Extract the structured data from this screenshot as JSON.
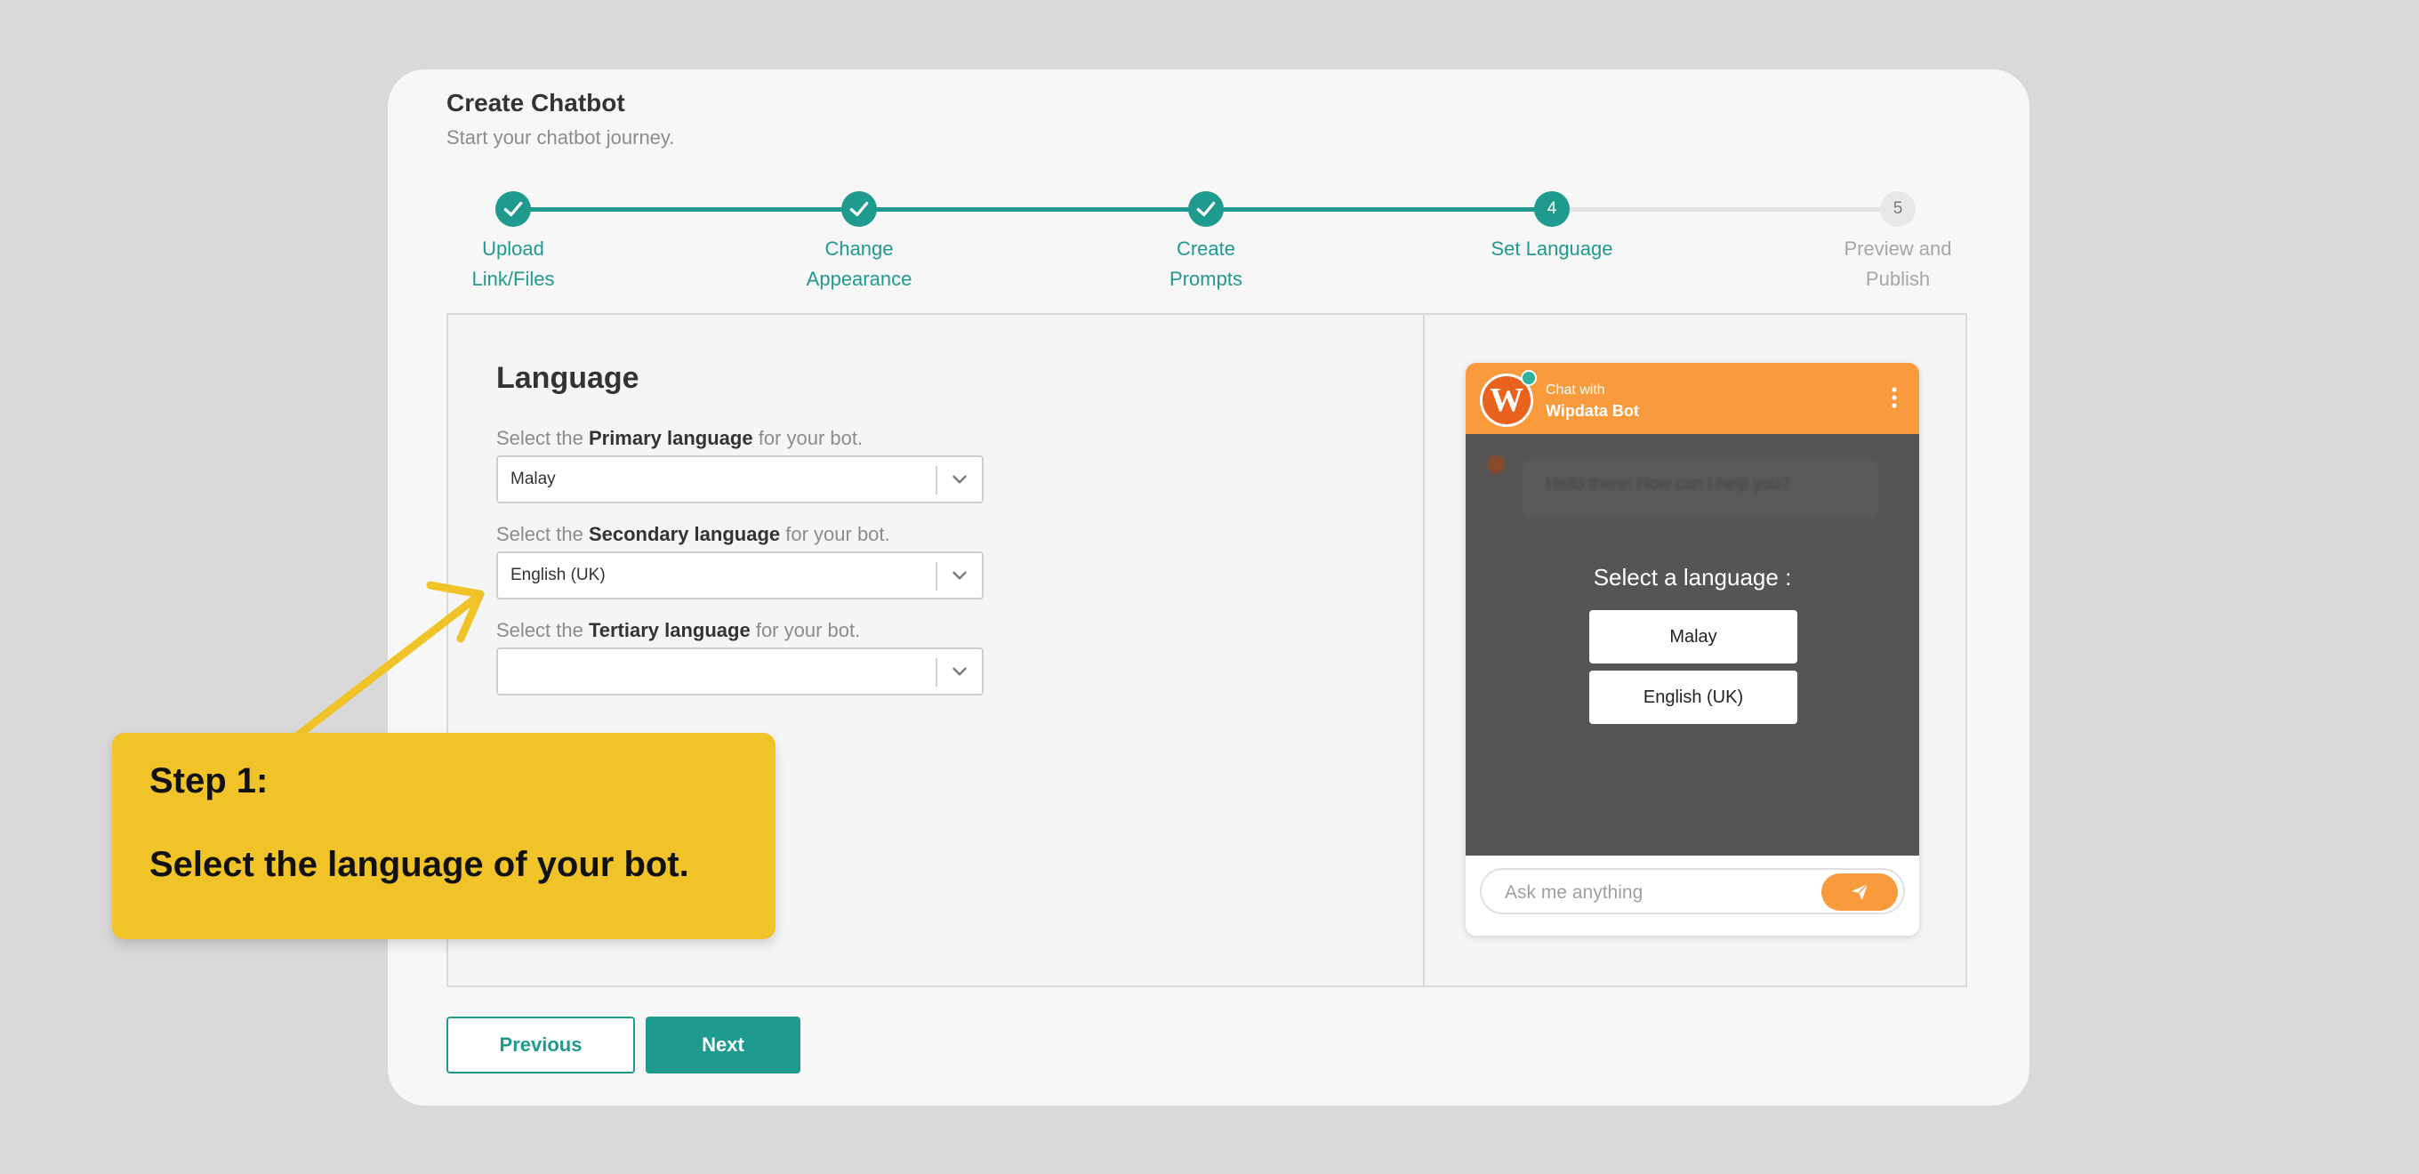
{
  "header": {
    "title": "Create Chatbot",
    "subtitle": "Start your chatbot journey."
  },
  "stepper": {
    "steps": [
      {
        "number": "1",
        "label_line1": "Upload",
        "label_line2": "Link/Files",
        "state": "completed"
      },
      {
        "number": "2",
        "label_line1": "Change",
        "label_line2": "Appearance",
        "state": "completed"
      },
      {
        "number": "3",
        "label_line1": "Create",
        "label_line2": "Prompts",
        "state": "completed"
      },
      {
        "number": "4",
        "label_line1": "Set Language",
        "label_line2": "",
        "state": "active"
      },
      {
        "number": "5",
        "label_line1": "Preview and",
        "label_line2": "Publish",
        "state": "pending"
      }
    ]
  },
  "language": {
    "title": "Language",
    "primary": {
      "prefix": "Select the ",
      "bold": "Primary language",
      "suffix": " for your bot.",
      "value": "Malay"
    },
    "secondary": {
      "prefix": "Select the ",
      "bold": "Secondary language",
      "suffix": " for your bot.",
      "value": "English (UK)"
    },
    "tertiary": {
      "prefix": "Select the ",
      "bold": "Tertiary language",
      "suffix": " for your bot.",
      "value": ""
    }
  },
  "chat_preview": {
    "chat_with": "Chat with",
    "bot_name": "Wipdata Bot",
    "logo_letter": "W",
    "greeting": "Hello there! How can I help you?",
    "select_title": "Select a language :",
    "options": [
      "Malay",
      "English (UK)"
    ],
    "input_placeholder": "Ask me anything"
  },
  "buttons": {
    "previous": "Previous",
    "next": "Next"
  },
  "callout": {
    "line1": "Step 1:",
    "line2": "Select the language of your bot."
  },
  "colors": {
    "accent": "#1f9a8e",
    "chat_orange": "#f99a3c",
    "callout_yellow": "#f0c429",
    "background": "#d9d9d9"
  }
}
